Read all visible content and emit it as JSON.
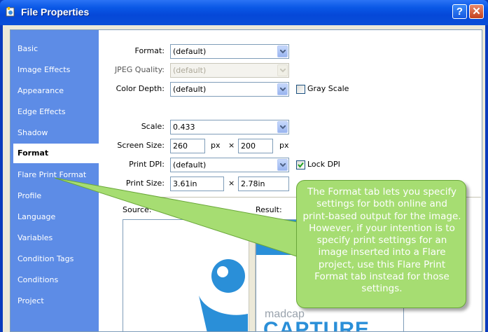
{
  "window": {
    "title": "File Properties",
    "help_label": "?",
    "close_label": "✕"
  },
  "sidebar": {
    "items": [
      {
        "label": "Basic",
        "active": false
      },
      {
        "label": "Image Effects",
        "active": false
      },
      {
        "label": "Appearance",
        "active": false
      },
      {
        "label": "Edge Effects",
        "active": false
      },
      {
        "label": "Shadow",
        "active": false
      },
      {
        "label": "Format",
        "active": true
      },
      {
        "label": "Flare Print Format",
        "active": false
      },
      {
        "label": "Profile",
        "active": false
      },
      {
        "label": "Language",
        "active": false
      },
      {
        "label": "Variables",
        "active": false
      },
      {
        "label": "Condition Tags",
        "active": false
      },
      {
        "label": "Conditions",
        "active": false
      },
      {
        "label": "Project",
        "active": false
      }
    ]
  },
  "form": {
    "format": {
      "label": "Format:",
      "value": "(default)"
    },
    "jpeg_quality": {
      "label": "JPEG Quality:",
      "value": "(default)",
      "disabled": true
    },
    "color_depth": {
      "label": "Color Depth:",
      "value": "(default)"
    },
    "gray_scale": {
      "label": "Gray Scale",
      "checked": false
    },
    "scale": {
      "label": "Scale:",
      "value": "0.433"
    },
    "screen_size": {
      "label": "Screen Size:",
      "width": "260",
      "height": "200",
      "unit": "px",
      "times": "×"
    },
    "print_dpi": {
      "label": "Print DPI:",
      "value": "(default)"
    },
    "lock_dpi": {
      "label": "Lock DPI",
      "checked": true
    },
    "print_size": {
      "label": "Print Size:",
      "width": "3.61in",
      "height": "2.78in",
      "times": "×"
    }
  },
  "preview": {
    "source_label": "Source:",
    "result_label": "Result:",
    "logo_small": "madcap",
    "logo_big": "CAPTURE"
  },
  "callout": {
    "text": "The Format tab lets you specify settings for both online and print-based output for the image. However, if your intention is to specify print settings for an image inserted into a Flare project, use this Flare Print Format tab instead for those settings."
  },
  "colors": {
    "sidebar": "#5d8ce6",
    "callout": "#a6dd72",
    "titlebar": "#0548d8"
  }
}
